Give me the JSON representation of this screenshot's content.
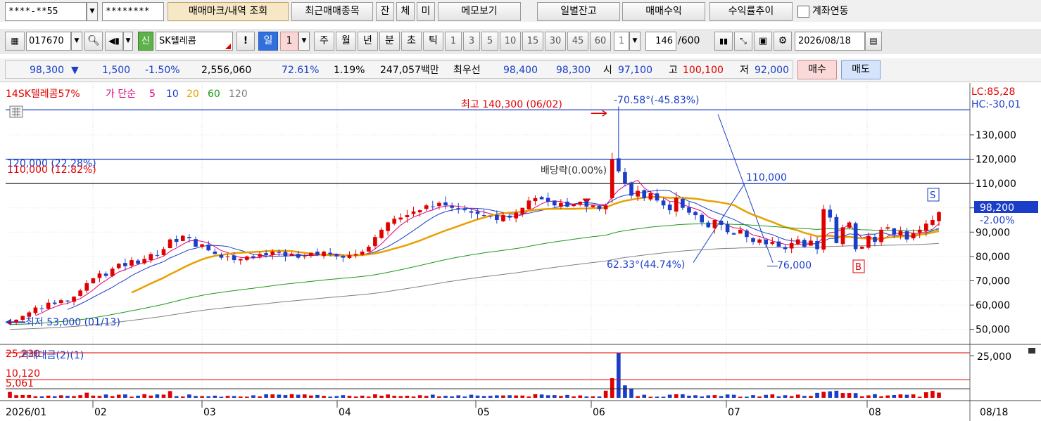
{
  "toolbar1": {
    "account_no": "****-**55",
    "password": "********",
    "btn_trade_mark": "매매마크/내역 조회",
    "btn_recent": "최근매매종목",
    "btn_jan": "잔",
    "btn_che": "체",
    "btn_mi": "미",
    "btn_memo": "메모보기",
    "btn_daily_balance": "일별잔고",
    "btn_trade_profit": "매매수익",
    "btn_return_trend": "수익률추이",
    "link_account_label": "계좌연동"
  },
  "toolbar2": {
    "stock_code": "017670",
    "badge_sin": "신",
    "stock_name": "SK텔레콤",
    "btn_alert": "!",
    "period_il": "일",
    "period_num": "1",
    "period_ju": "주",
    "period_wol": "월",
    "period_nyeon": "년",
    "period_bun": "분",
    "period_cho": "초",
    "period_tik": "틱",
    "min_options": [
      "1",
      "3",
      "5",
      "10",
      "15",
      "30",
      "45",
      "60"
    ],
    "custom_value": "1",
    "count": "146",
    "count_max": "/600",
    "date": "2026/08/18"
  },
  "quote": {
    "price": "98,300",
    "arrow": "▼",
    "change": "1,500",
    "change_pct": "-1.50%",
    "volume": "2,556,060",
    "ratio1": "72.61%",
    "ratio2": "1.19%",
    "amount": "247,057백만",
    "best_label": "최우선",
    "best_ask": "98,400",
    "best_bid": "98,300",
    "open_label": "시",
    "open": "97,100",
    "high_label": "고",
    "high": "100,100",
    "low_label": "저",
    "low": "92,000",
    "btn_buy": "매수",
    "btn_sell": "매도"
  },
  "chart_data": {
    "type": "candlestick",
    "legend": {
      "prefix": "14SK텔레콤57%",
      "ma_label": "가 단순",
      "ma_periods": [
        "5",
        "10",
        "20",
        "60",
        "120"
      ],
      "ma_colors": [
        "#e0007a",
        "#1a3ec8",
        "#e8a000",
        "#1a9a1a",
        "#808080"
      ]
    },
    "top_right_labels": [
      "LC:85,28",
      "HC:-30,01"
    ],
    "y_axis": {
      "min": 45000,
      "max": 145000,
      "ticks": [
        "50,000",
        "60,000",
        "70,000",
        "80,000",
        "90,000",
        "100,000",
        "110,000",
        "120,000",
        "130,000"
      ]
    },
    "x_axis": {
      "labels": [
        "2026/01",
        "02",
        "03",
        "04",
        "05",
        "06",
        "07",
        "08"
      ],
      "right_label": "08/18"
    },
    "current_price_tag": "98,200",
    "current_change_tag": "-2.00%",
    "annotations": {
      "high": "최고 140,300 (06/02)",
      "low": "최저 53,000 (01/13)",
      "line_120000": "120,000 (22.28%)",
      "line_110000": "110,000 (12.82%)",
      "dividend": "배당락(0.00%)",
      "angle_down": "-70.58°(-45.83%)",
      "angle_up": "62.33°(44.74%)",
      "trend_110000": "110,000",
      "trend_76000": "76,000",
      "mark_buy": "B",
      "mark_sell": "S"
    },
    "volume_panel": {
      "title": "거래대금(2)(1)",
      "ticks": [
        "25,000"
      ],
      "levels": [
        "25,230",
        "10,120",
        "5,061"
      ]
    },
    "closes": [
      53000,
      54000,
      55500,
      57000,
      59000,
      58500,
      61000,
      60500,
      62000,
      61500,
      63500,
      66000,
      69000,
      71000,
      73000,
      72000,
      75000,
      77000,
      76000,
      78500,
      77000,
      79000,
      81000,
      80500,
      83000,
      87000,
      86000,
      88500,
      87500,
      84000,
      85000,
      82500,
      81000,
      79500,
      80000,
      78500,
      79000,
      80000,
      79500,
      81000,
      80500,
      82000,
      81500,
      80000,
      81000,
      79500,
      80000,
      81500,
      80500,
      82000,
      81000,
      80000,
      79500,
      80500,
      81000,
      82000,
      84000,
      88000,
      91000,
      94000,
      95500,
      96000,
      97000,
      98500,
      99000,
      101000,
      100500,
      102000,
      101000,
      100000,
      99500,
      99000,
      98000,
      97500,
      97000,
      96500,
      95000,
      97000,
      96000,
      98000,
      100000,
      103000,
      104000,
      103500,
      102500,
      101000,
      102000,
      100500,
      101500,
      102500,
      100500,
      101000,
      99500,
      101000,
      120000,
      115000,
      110000,
      105000,
      107000,
      104000,
      106000,
      103000,
      101000,
      99000,
      104000,
      100000,
      98000,
      97000,
      94000,
      92000,
      95000,
      93000,
      90000,
      89000,
      91000,
      88000,
      86000,
      87000,
      85000,
      86000,
      84000,
      83000,
      85500,
      87000,
      84000,
      86500,
      83000,
      99500,
      96000,
      85500,
      92000,
      94000,
      83000,
      84000,
      88500,
      86000,
      91000,
      92000,
      89000,
      90500,
      87000,
      89500,
      91000,
      93500,
      95000,
      98200
    ]
  }
}
